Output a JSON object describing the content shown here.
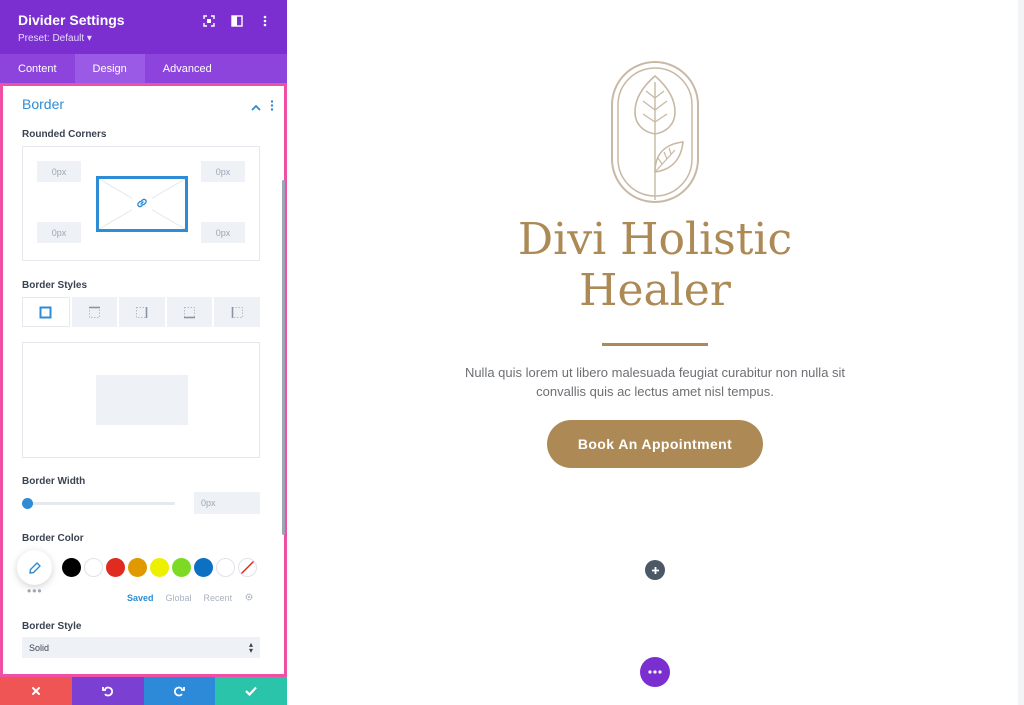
{
  "panel": {
    "title": "Divider Settings",
    "preset": "Preset: Default ▾",
    "tabs": [
      {
        "label": "Content"
      },
      {
        "label": "Design"
      },
      {
        "label": "Advanced"
      }
    ],
    "active_tab": "Design",
    "section": {
      "title": "Border",
      "rounded_corners_label": "Rounded Corners",
      "corners": {
        "top_left": "0px",
        "top_right": "0px",
        "bottom_left": "0px",
        "bottom_right": "0px"
      },
      "border_styles_label": "Border Styles",
      "border_width_label": "Border Width",
      "border_width_value": "0px",
      "border_width_level": 0,
      "border_color_label": "Border Color",
      "swatches": [
        "#000000",
        "#ffffff",
        "#e02b20",
        "#e09900",
        "#edf000",
        "#7cda24",
        "#0c71c3",
        "#ffffff"
      ],
      "palette_tabs": {
        "saved": "Saved",
        "global": "Global",
        "recent": "Recent"
      },
      "border_style_label": "Border Style",
      "border_style_value": "Solid"
    },
    "colors": {
      "header": "#7b2fd1",
      "accent": "#2e8cd5",
      "highlight": "#ef4fa5"
    },
    "footer": {
      "cancel_color": "#ef5555",
      "undo_color": "#7b3fd1",
      "redo_color": "#2d8ad8",
      "save_color": "#29c4a9"
    }
  },
  "canvas": {
    "title_line1": "Divi Holistic",
    "title_line2": "Healer",
    "body_text": "Nulla quis lorem ut libero malesuada feugiat curabitur non nulla sit convallis quis ac lectus amet nisl tempus.",
    "button_label": "Book An Appointment",
    "brand_color": "#ad8a55"
  }
}
